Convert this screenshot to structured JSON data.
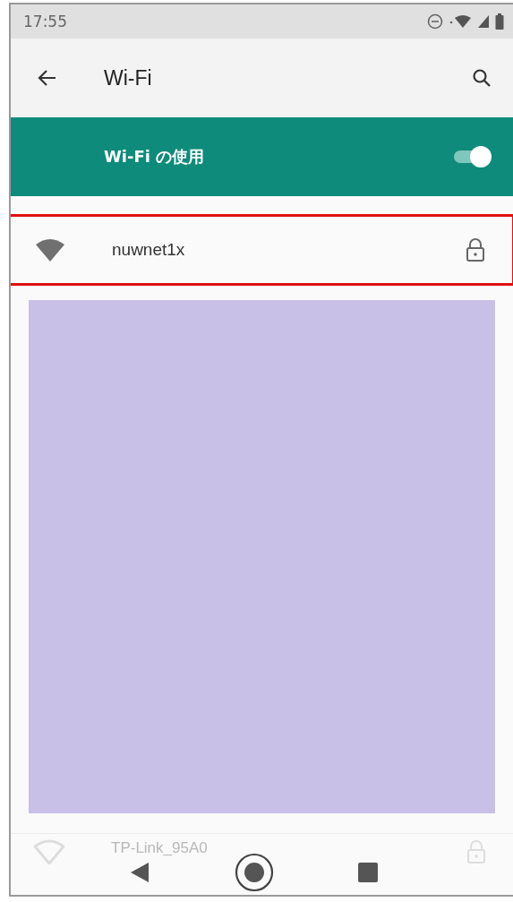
{
  "status_bar": {
    "time": "17:55"
  },
  "app_bar": {
    "title": "Wi-Fi"
  },
  "wifi_toggle": {
    "label": "Wi-Fi の使用",
    "on": true
  },
  "networks": [
    {
      "name": "nuwnet1x",
      "secured": true,
      "highlighted": true,
      "dimmed": false
    },
    {
      "name": "TP-Link_95A0",
      "secured": true,
      "highlighted": false,
      "dimmed": true
    }
  ],
  "covered_area": {
    "kind": "redaction"
  }
}
